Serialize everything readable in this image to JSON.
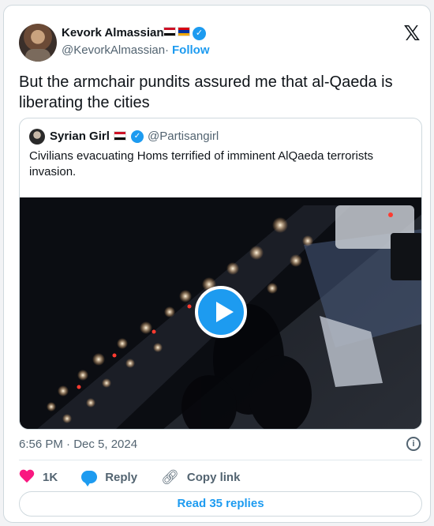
{
  "author": {
    "name": "Kevork Almassian",
    "handle": "@KevorkAlmassian",
    "separator": "·",
    "follow_label": "Follow",
    "flags": [
      "syria-flag",
      "armenia-flag"
    ],
    "verified": true
  },
  "tweet": {
    "text": "But the armchair pundits assured me that al-Qaeda is liberating the cities"
  },
  "quoted": {
    "name": "Syrian Girl",
    "handle": "@Partisangirl",
    "flag": "syria-flag",
    "verified": true,
    "text": "Civilians evacuating Homs terrified of imminent AlQaeda terrorists invasion.",
    "media": {
      "type": "video",
      "icon": "play-icon"
    }
  },
  "meta": {
    "timestamp": "6:56 PM · Dec 5, 2024",
    "info_icon": "info-icon"
  },
  "actions": {
    "like_count": "1K",
    "reply_label": "Reply",
    "copy_label": "Copy link"
  },
  "replies_button": "Read 35 replies",
  "colors": {
    "accent": "#1d9bf0",
    "like": "#f91880",
    "text": "#0f1419",
    "muted": "#536471",
    "border": "#cfd9de"
  }
}
